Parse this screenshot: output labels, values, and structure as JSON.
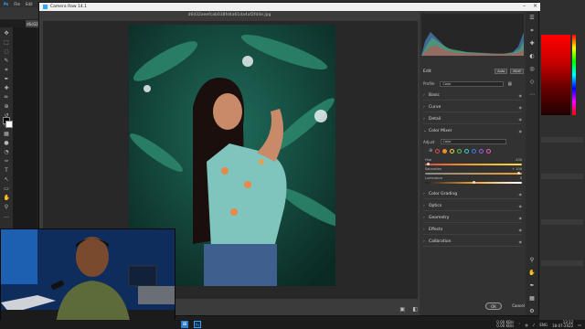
{
  "ps": {
    "menu": [
      "Ps",
      "File",
      "Edit",
      "Image"
    ],
    "doc_tab": "d6d32ae",
    "tools": [
      "move-icon",
      "marquee-icon",
      "lasso-icon",
      "quick-select-icon",
      "crop-icon",
      "eyedropper-icon",
      "healing-icon",
      "brush-icon",
      "stamp-icon",
      "history-brush-icon",
      "eraser-icon",
      "gradient-icon",
      "blur-icon",
      "dodge-icon",
      "pen-icon",
      "type-icon",
      "path-select-icon",
      "shape-icon",
      "hand-icon",
      "zoom-icon",
      "more-icon"
    ],
    "tool_glyphs": [
      "✥",
      "⬚",
      "◌",
      "✎",
      "⌗",
      "✒",
      "✚",
      "✏",
      "⊕",
      "↺",
      "⌫",
      "▦",
      "●",
      "◔",
      "✑",
      "T",
      "↖",
      "▭",
      "✋",
      "⚲",
      "…"
    ],
    "foreground": "#000000",
    "background": "#ffffff"
  },
  "camera_raw": {
    "title": "Camera Raw 14.1",
    "filename": "d6d32aeefcab038fd4a61da4af2fd4e.jpg",
    "edit_label": "Edit",
    "auto_label": "Auto",
    "bw_label": "B&W",
    "profile_label": "Profile",
    "profile_value": "Color",
    "sections_top": [
      "Basic",
      "Curve",
      "Detail"
    ],
    "color_mixer_label": "Color Mixer",
    "adjust_label": "Adjust",
    "adjust_value": "Color",
    "color_dots": [
      "#e34a3a",
      "#f08a2a",
      "#f2d23a",
      "#56c04a",
      "#3ccfc7",
      "#3d7de6",
      "#9a5be6",
      "#e65bc4"
    ],
    "selected_dot_index": 1,
    "sliders": [
      {
        "label": "Hue",
        "value": "-100",
        "position": 0.02
      },
      {
        "label": "Saturation",
        "value": "+ 100",
        "position": 0.98
      },
      {
        "label": "Luminance",
        "value": "0",
        "position": 0.5
      }
    ],
    "sections_bottom": [
      "Color Grading",
      "Optics",
      "Geometry",
      "Effects",
      "Calibration"
    ],
    "ok_label": "OK",
    "cancel_label": "Cancel"
  },
  "taskbar": {
    "net_up": "0.00 KB/s",
    "net_down": "0.00 KB/s",
    "lang": "ENG",
    "time": "13:12",
    "date": "18-07-2022"
  }
}
